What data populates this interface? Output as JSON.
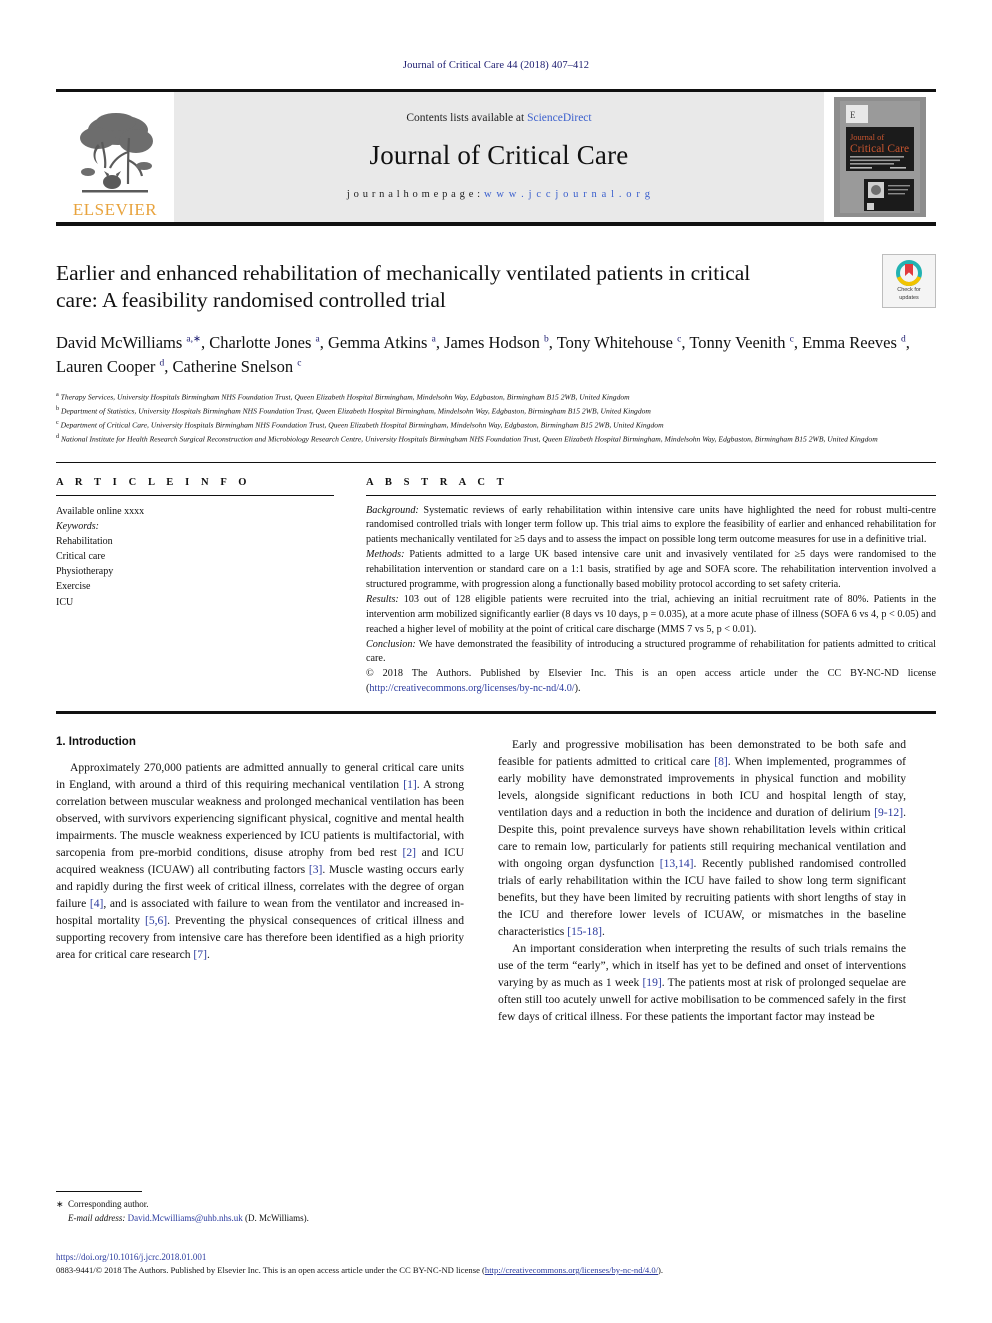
{
  "running_head": "Journal of Critical Care 44 (2018) 407–412",
  "masthead": {
    "publisher_name": "ELSEVIER",
    "contents_prefix": "Contents lists available at ",
    "contents_link": "ScienceDirect",
    "journal_title": "Journal of Critical Care",
    "homepage_label": "j o u r n a l   h o m e p a g e :",
    "homepage_url": "w w w . j c c j o u r n a l . o r g",
    "cover_title_line1": "Journal of",
    "cover_title_line2": "Critical Care"
  },
  "article": {
    "title": "Earlier and enhanced rehabilitation of mechanically ventilated patients in critical care: A feasibility randomised controlled trial",
    "crossmark_line1": "Check for",
    "crossmark_line2": "updates",
    "authors": [
      {
        "name": "David McWilliams",
        "sup": "a,∗",
        "sep": ", "
      },
      {
        "name": "Charlotte Jones",
        "sup": "a",
        "sep": ", "
      },
      {
        "name": "Gemma Atkins",
        "sup": "a",
        "sep": ", "
      },
      {
        "name": "James Hodson",
        "sup": "b",
        "sep": ", "
      },
      {
        "name": "Tony Whitehouse",
        "sup": "c",
        "sep": ", "
      },
      {
        "name": "Tonny Veenith",
        "sup": "c",
        "sep": ", "
      },
      {
        "name": "Emma Reeves",
        "sup": "d",
        "sep": ", "
      },
      {
        "name": "Lauren Cooper",
        "sup": "d",
        "sep": ", "
      },
      {
        "name": "Catherine Snelson",
        "sup": "c",
        "sep": ""
      }
    ],
    "affiliations": [
      {
        "mark": "a",
        "text": "Therapy Services, University Hospitals Birmingham NHS Foundation Trust, Queen Elizabeth Hospital Birmingham, Mindelsohn Way, Edgbaston, Birmingham B15 2WB, United Kingdom"
      },
      {
        "mark": "b",
        "text": "Department of Statistics, University Hospitals Birmingham NHS Foundation Trust, Queen Elizabeth Hospital Birmingham, Mindelsohn Way, Edgbaston, Birmingham B15 2WB, United Kingdom"
      },
      {
        "mark": "c",
        "text": "Department of Critical Care, University Hospitals Birmingham NHS Foundation Trust, Queen Elizabeth Hospital Birmingham, Mindelsohn Way, Edgbaston, Birmingham B15 2WB, United Kingdom"
      },
      {
        "mark": "d",
        "text": "National Institute for Health Research Surgical Reconstruction and Microbiology Research Centre, University Hospitals Birmingham NHS Foundation Trust, Queen Elizabeth Hospital Birmingham, Mindelsohn Way, Edgbaston, Birmingham B15 2WB, United Kingdom"
      }
    ]
  },
  "article_info": {
    "heading": "A R T I C L E   I N F O",
    "history": "Available online xxxx",
    "keywords_label": "Keywords:",
    "keywords": [
      "Rehabilitation",
      "Critical care",
      "Physiotherapy",
      "Exercise",
      "ICU"
    ]
  },
  "abstract": {
    "heading": "A B S T R A C T",
    "sections": [
      {
        "label": "Background:",
        "text": " Systematic reviews of early rehabilitation within intensive care units have highlighted the need for robust multi-centre randomised controlled trials with longer term follow up. This trial aims to explore the feasibility of earlier and enhanced rehabilitation for patients mechanically ventilated for ≥5 days and to assess the impact on possible long term outcome measures for use in a definitive trial."
      },
      {
        "label": "Methods:",
        "text": " Patients admitted to a large UK based intensive care unit and invasively ventilated for ≥5 days were randomised to the rehabilitation intervention or standard care on a 1:1 basis, stratified by age and SOFA score. The rehabilitation intervention involved a structured programme, with progression along a functionally based mobility protocol according to set safety criteria."
      },
      {
        "label": "Results:",
        "text": " 103 out of 128 eligible patients were recruited into the trial, achieving an initial recruitment rate of 80%. Patients in the intervention arm mobilized significantly earlier (8 days vs 10 days, p = 0.035), at a more acute phase of illness (SOFA 6 vs 4, p < 0.05) and reached a higher level of mobility at the point of critical care discharge (MMS 7 vs 5, p < 0.01)."
      },
      {
        "label": "Conclusion:",
        "text": " We have demonstrated the feasibility of introducing a structured programme of rehabilitation for patients admitted to critical care."
      }
    ],
    "copyright_text": "© 2018 The Authors. Published by Elsevier Inc. This is an open access article under the CC BY-NC-ND license (",
    "copyright_link": "http://creativecommons.org/licenses/by-nc-nd/4.0/",
    "copyright_tail": ")."
  },
  "introduction": {
    "heading": "1. Introduction",
    "left_paragraph": "Approximately 270,000 patients are admitted annually to general critical care units in England, with around a third of this requiring mechanical ventilation [1]. A strong correlation between muscular weakness and prolonged mechanical ventilation has been observed, with survivors experiencing significant physical, cognitive and mental health impairments. The muscle weakness experienced by ICU patients is multifactorial, with sarcopenia from pre-morbid conditions, disuse atrophy from bed rest [2] and ICU acquired weakness (ICUAW) all contributing factors [3]. Muscle wasting occurs early and rapidly during the first week of critical illness, correlates with the degree of organ failure [4], and is associated with failure to wean from the ventilator and increased in-hospital mortality [5,6]. Preventing the physical consequences of critical illness and supporting recovery from intensive care has therefore been identified as a high priority area for critical care research [7].",
    "right_paragraph_1": "Early and progressive mobilisation has been demonstrated to be both safe and feasible for patients admitted to critical care [8]. When implemented, programmes of early mobility have demonstrated improvements in physical function and mobility levels, alongside significant reductions in both ICU and hospital length of stay, ventilation days and a reduction in both the incidence and duration of delirium [9-12]. Despite this, point prevalence surveys have shown rehabilitation levels within critical care to remain low, particularly for patients still requiring mechanical ventilation and with ongoing organ dysfunction [13,14]. Recently published randomised controlled trials of early rehabilitation within the ICU have failed to show long term significant benefits, but they have been limited by recruiting patients with short lengths of stay in the ICU and therefore lower levels of ICUAW, or mismatches in the baseline characteristics [15-18].",
    "right_paragraph_2": "An important consideration when interpreting the results of such trials remains the use of the term “early”, which in itself has yet to be defined and onset of interventions varying by as much as 1 week [19]. The patients most at risk of prolonged sequelae are often still too acutely unwell for active mobilisation to be commenced safely in the first few days of critical illness. For these patients the important factor may instead be"
  },
  "footnote": {
    "star": "∗",
    "corresponding": "Corresponding author.",
    "email_label": "E-mail address:",
    "email": "David.Mcwilliams@uhb.nhs.uk",
    "email_owner": "(D. McWilliams)."
  },
  "page_footer": {
    "doi": "https://doi.org/10.1016/j.jcrc.2018.01.001",
    "issn_copy": "0883-9441/© 2018 The Authors. Published by Elsevier Inc. This is an open access article under the CC BY-NC-ND license (",
    "license_link": "http://creativecommons.org/licenses/by-nc-nd/4.0/",
    "license_tail": ")."
  },
  "colors": {
    "link_blue": "#2a3a9e",
    "science_direct_blue": "#3a5fcd",
    "elsevier_orange": "#E8A33D",
    "masthead_grey": "#e9e9e9"
  }
}
